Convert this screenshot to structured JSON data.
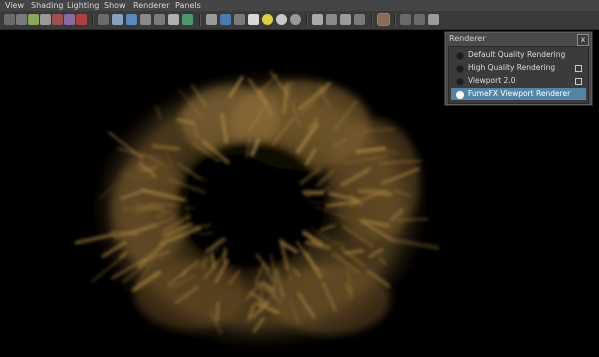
{
  "menu": [
    "View",
    "Shading",
    "Lighting",
    "Show",
    "Renderer",
    "Panels"
  ],
  "toolbar": {
    "icons": [
      "camera-icon",
      "bookmark-icon",
      "film-gate-icon",
      "image-plane-icon",
      "grid-icon",
      "resolution-gate-icon",
      "isolate-icon",
      "wireframe-icon",
      "smooth-shade-icon",
      "textured-icon",
      "use-lights-icon",
      "shadows-icon",
      "sphere-icon",
      "cube-icon",
      "checker-icon",
      "sun-icon",
      "shaded-sphere-icon",
      "dome-icon",
      "fog-icon",
      "ao-icon",
      "motion-blur-icon",
      "highlight-icon",
      "xray-icon",
      "frame-icon",
      "share-icon"
    ],
    "accent": "#c07a2e"
  },
  "renderer_panel": {
    "title": "Renderer",
    "close_label": "x",
    "items": [
      {
        "label": "Default Quality Rendering",
        "has_options": false,
        "selected": false
      },
      {
        "label": "High Quality Rendering",
        "has_options": true,
        "selected": false
      },
      {
        "label": "Viewport 2.0",
        "has_options": true,
        "selected": false
      },
      {
        "label": "FumeFX Viewport Renderer",
        "has_options": false,
        "selected": true
      }
    ],
    "highlight_color": "#5285a6"
  },
  "viewport": {
    "smoke_color": "#b8904a"
  }
}
